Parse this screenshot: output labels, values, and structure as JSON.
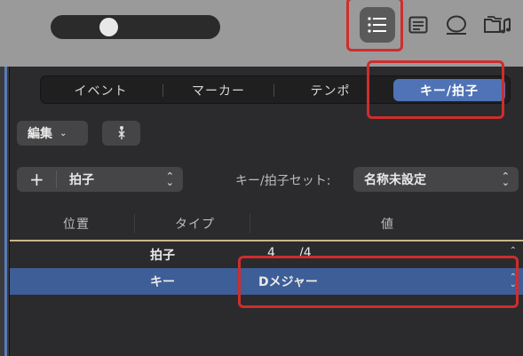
{
  "toolbar": {
    "zoom_level": 0.32,
    "buttons": [
      {
        "name": "list-editors-icon",
        "active": true
      },
      {
        "name": "notepad-icon",
        "active": false
      },
      {
        "name": "loop-browser-icon",
        "active": false
      },
      {
        "name": "browsers-icon",
        "active": false
      }
    ]
  },
  "tabs": [
    {
      "label": "イベント",
      "selected": false
    },
    {
      "label": "マーカー",
      "selected": false
    },
    {
      "label": "テンポ",
      "selected": false
    },
    {
      "label": "キー/拍子",
      "selected": true
    }
  ],
  "edit_menu": {
    "label": "編集",
    "chevron": "⌄"
  },
  "add_button": {
    "label": "+"
  },
  "type_popup": {
    "label": "拍子"
  },
  "key_sig_set": {
    "label": "キー/拍子セット:",
    "value": "名称未設定"
  },
  "columns": {
    "position": "位置",
    "type": "タイプ",
    "value": "値"
  },
  "rows": [
    {
      "position": "",
      "type": "拍子",
      "value_num": "4",
      "value_den": "/4",
      "selected": false
    },
    {
      "position": "",
      "type": "キー",
      "value": "Dメジャー",
      "selected": true
    }
  ],
  "colors": {
    "accent": "#4f73b6",
    "selected_row": "#3d5e96",
    "annotation": "#cf2d2d"
  }
}
